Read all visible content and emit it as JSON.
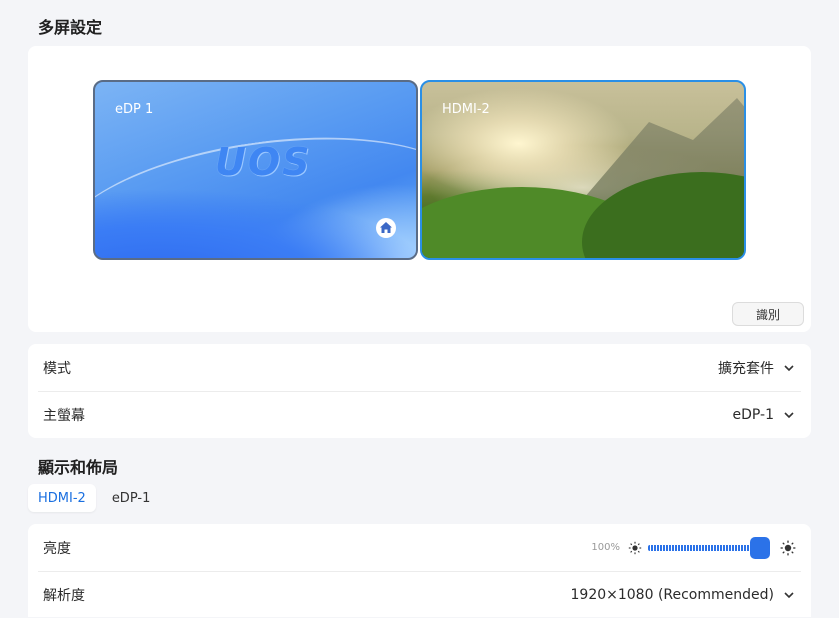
{
  "multi_screen": {
    "title": "多屏設定",
    "monitors": [
      {
        "label": "eDP 1",
        "logo": "UOS",
        "primary_icon": "home-icon"
      },
      {
        "label": "HDMI-2"
      }
    ],
    "identify_label": "識別"
  },
  "settings": {
    "mode_label": "模式",
    "mode_value": "擴充套件",
    "main_screen_label": "主螢幕",
    "main_screen_value": "eDP-1"
  },
  "display_layout": {
    "title": "顯示和佈局",
    "tabs": [
      {
        "label": "HDMI-2",
        "active": true
      },
      {
        "label": "eDP-1",
        "active": false
      }
    ],
    "brightness_label": "亮度",
    "brightness_percent_text": "100%",
    "brightness_level": 1.0,
    "resolution_label": "解析度",
    "resolution_value": "1920×1080 (Recommended)"
  },
  "colors": {
    "accent": "#2b72e8",
    "hdmi_border": "#2a8fe6"
  }
}
